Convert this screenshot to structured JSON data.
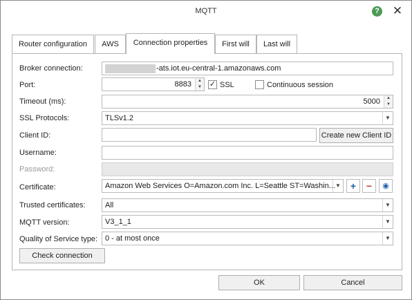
{
  "window": {
    "title": "MQTT"
  },
  "tabs": [
    {
      "label": "Router configuration"
    },
    {
      "label": "AWS"
    },
    {
      "label": "Connection properties"
    },
    {
      "label": "First will"
    },
    {
      "label": "Last will"
    }
  ],
  "active_tab": "Connection properties",
  "form": {
    "broker": {
      "label": "Broker connection:",
      "value_suffix": "-ats.iot.eu-central-1.amazonaws.com"
    },
    "port": {
      "label": "Port:",
      "value": "8883"
    },
    "ssl": {
      "label": "SSL",
      "checked": true,
      "mark": "✓"
    },
    "continuous_session": {
      "label": "Continuous session",
      "checked": false
    },
    "timeout": {
      "label": "Timeout (ms):",
      "value": "5000"
    },
    "ssl_protocols": {
      "label": "SSL Protocols:",
      "value": "TLSv1.2"
    },
    "client_id": {
      "label": "Client ID:",
      "value": "",
      "button": "Create new Client ID"
    },
    "username": {
      "label": "Username:",
      "value": ""
    },
    "password": {
      "label": "Password:",
      "value": ""
    },
    "certificate": {
      "label": "Certificate:",
      "value": "Amazon Web Services O=Amazon.com Inc. L=Seattle ST=Washin..."
    },
    "trusted_certificates": {
      "label": "Trusted certificates:",
      "value": "All"
    },
    "mqtt_version": {
      "label": "MQTT version:",
      "value": "V3_1_1"
    },
    "qos": {
      "label": "Quality of Service type:",
      "value": "0 - at most once"
    },
    "check_connection": "Check connection"
  },
  "footer": {
    "ok": "OK",
    "cancel": "Cancel"
  },
  "colors": {
    "help_icon": "#4c9a55",
    "add_icon": "#1f5fa8",
    "remove_icon": "#c23b3b"
  }
}
